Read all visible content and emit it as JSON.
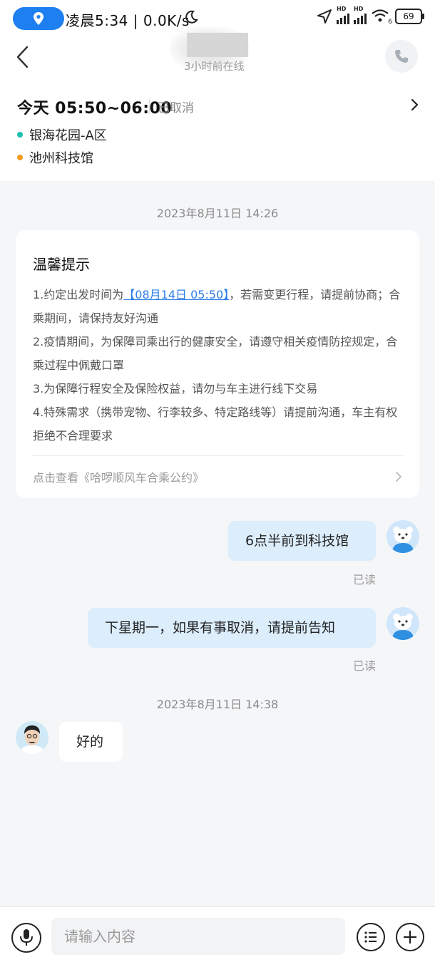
{
  "status_bar": {
    "time_text": "凌晨5:34 | 0.0K/s",
    "signal1": "HD",
    "signal2": "HD",
    "wifi_badge": "6",
    "battery": "69"
  },
  "header": {
    "subtitle": "3小时前在线",
    "icons": [
      "back-arrow-icon",
      "phone-icon"
    ]
  },
  "trip": {
    "time": "今天 05:50~06:00",
    "status": "已取消",
    "start": "银海花园-A区",
    "end": "池州科技馆",
    "colors": {
      "start": "#1dbfb0",
      "end": "#f59a23"
    }
  },
  "timestamps": [
    "2023年8月11日 14:26",
    "2023年8月11日 14:38"
  ],
  "notice": {
    "title": "温馨提示",
    "line1_pre": "1.约定出发时间为",
    "line1_highlight": "【08月14日 05:50】",
    "line1_post": "，若需变更行程，请提前协商；合乘期间，请保持友好沟通",
    "line2": "2.疫情期间，为保障司乘出行的健康安全，请遵守相关疫情防控规定，合乘过程中佩戴口罩",
    "line3": "3.为保障行程安全及保险权益，请勿与车主进行线下交易",
    "line4": "4.特殊需求（携带宠物、行李较多、特定路线等）请提前沟通，车主有权拒绝不合理要求",
    "link": "点击查看《哈啰顺风车合乘公约》"
  },
  "messages": [
    {
      "from": "me",
      "text": "6点半前到科技馆",
      "read": "已读"
    },
    {
      "from": "me",
      "text": "下星期一，如果有事取消，请提前告知",
      "read": "已读"
    },
    {
      "from": "peer",
      "text": "好的"
    }
  ],
  "input": {
    "placeholder": "请输入内容"
  },
  "colors": {
    "accent": "#2b7de9",
    "my_bubble": "#dcedfc",
    "location_pill": "#1e7ff0"
  }
}
